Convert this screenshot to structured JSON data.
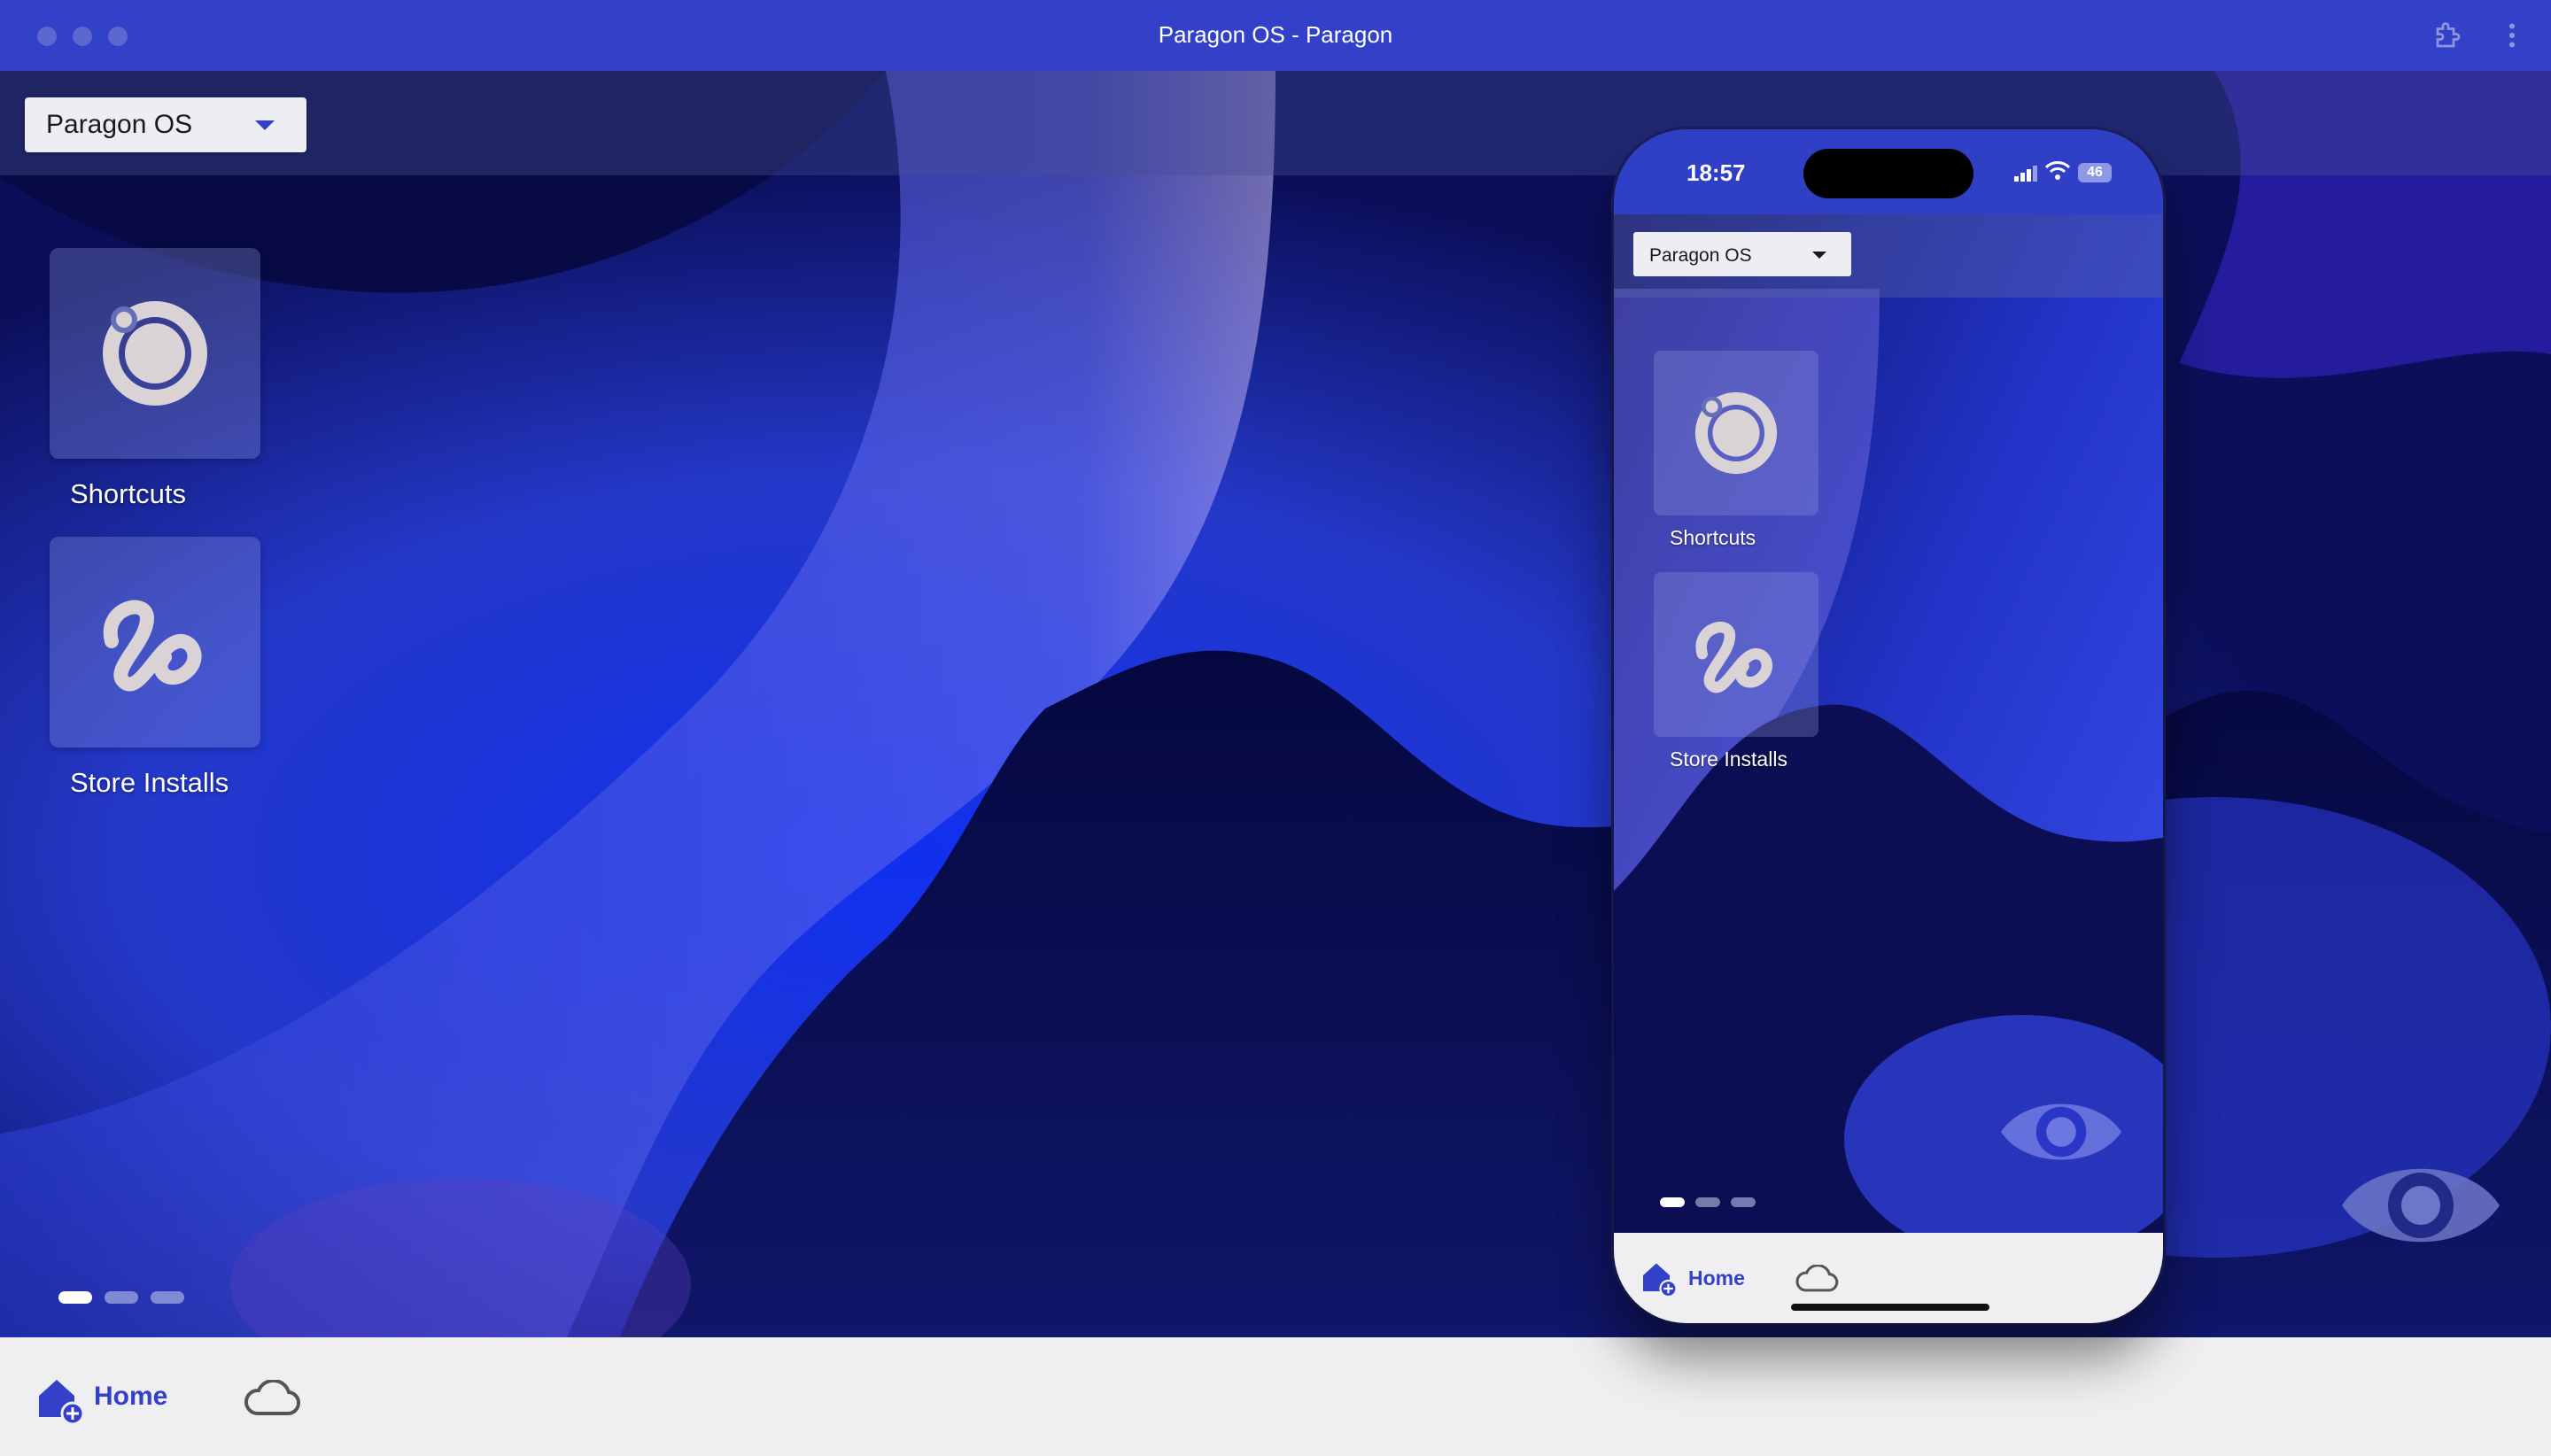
{
  "window": {
    "title": "Paragon OS - Paragon",
    "traffic_lights": [
      "close",
      "minimize",
      "zoom"
    ],
    "icons": [
      "extension-icon",
      "more-vert-icon"
    ]
  },
  "os_selector": {
    "value": "Paragon OS"
  },
  "desktop": {
    "apps": [
      {
        "label": "Shortcuts",
        "icon": "ring-icon"
      },
      {
        "label": "Store Installs",
        "icon": "squiggle-icon"
      }
    ],
    "pages": {
      "count": 3,
      "active": 1
    }
  },
  "bottom_nav": {
    "items": [
      {
        "label": "Home",
        "icon": "home-add-icon",
        "selected": true
      },
      {
        "label": "",
        "icon": "cloud-icon",
        "selected": false
      }
    ]
  },
  "phone": {
    "status": {
      "time": "18:57",
      "battery": "46"
    },
    "os_selector": {
      "value": "Paragon OS"
    },
    "apps": [
      {
        "label": "Shortcuts",
        "icon": "ring-icon"
      },
      {
        "label": "Store Installs",
        "icon": "squiggle-icon"
      }
    ],
    "pages": {
      "count": 3,
      "active": 1
    },
    "bottom_nav": {
      "items": [
        {
          "label": "Home",
          "icon": "home-add-icon",
          "selected": true
        },
        {
          "label": "",
          "icon": "cloud-icon",
          "selected": false
        }
      ]
    }
  },
  "colors": {
    "accent": "#3341c8",
    "wallpaper_dark": "#070a45",
    "wallpaper_bright": "#3a4cff",
    "nav_background": "#efeff1"
  }
}
